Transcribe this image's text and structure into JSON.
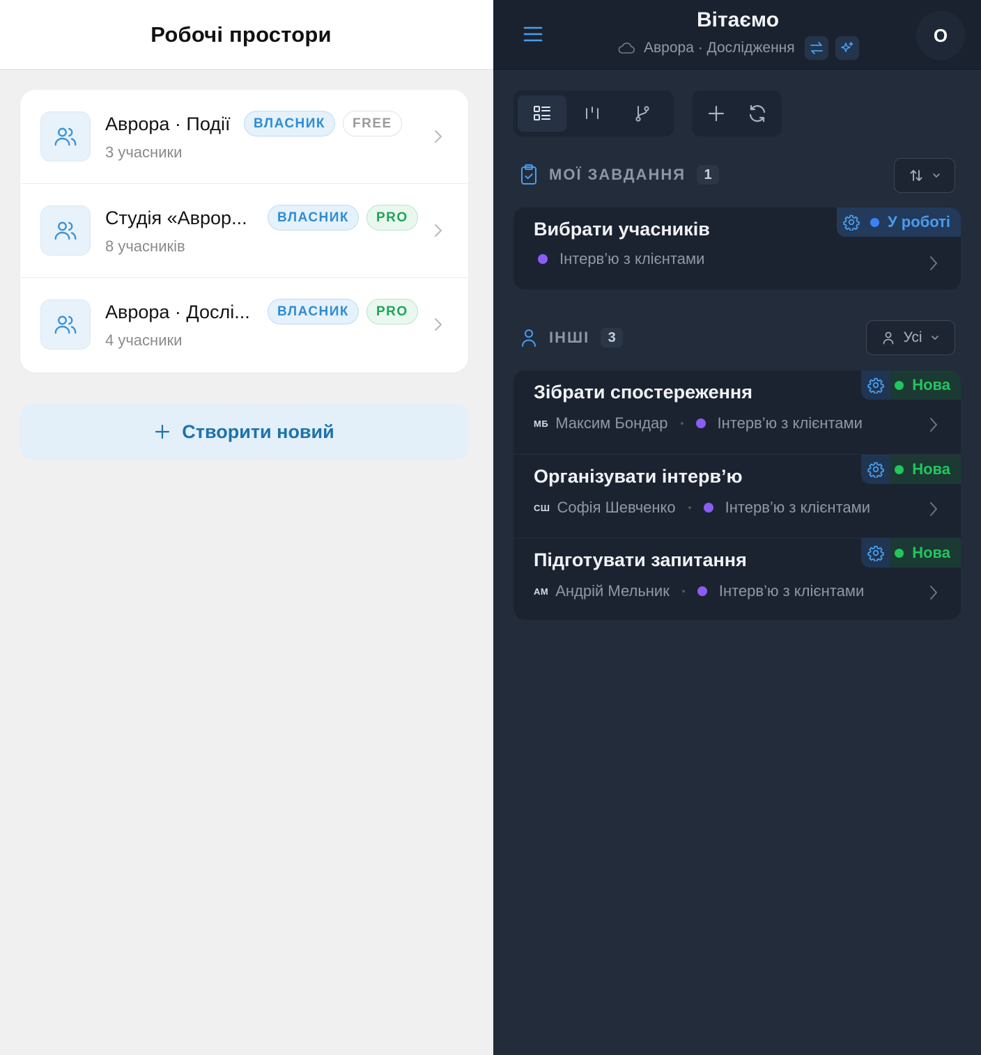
{
  "left": {
    "title": "Робочі простори",
    "workspaces": [
      {
        "name": "Аврора · Події",
        "members": "3 учасники",
        "role": "ВЛАСНИК",
        "plan": "FREE"
      },
      {
        "name": "Студія «Аврор...",
        "members": "8 учасників",
        "role": "ВЛАСНИК",
        "plan": "PRO"
      },
      {
        "name": "Аврора · Дослі...",
        "members": "4 учасники",
        "role": "ВЛАСНИК",
        "plan": "PRO"
      }
    ],
    "create_label": "Створити новий"
  },
  "right": {
    "greeting": "Вітаємо",
    "workspace": "Аврора · Дослідження",
    "avatar": "О",
    "my_tasks": {
      "title": "МОЇ ЗАВДАННЯ",
      "count": "1",
      "tasks": [
        {
          "title": "Вибрати учасників",
          "project": "Інтерв’ю з клієнтами",
          "status": "У роботі"
        }
      ]
    },
    "others": {
      "title": "ІНШІ",
      "count": "3",
      "filter": "Усі",
      "tasks": [
        {
          "title": "Зібрати спостереження",
          "initials": "МБ",
          "assignee": "Максим Бондар",
          "project": "Інтерв’ю з клієнтами",
          "status": "Нова"
        },
        {
          "title": "Організувати інтерв’ю",
          "initials": "СШ",
          "assignee": "Софія Шевченко",
          "project": "Інтерв’ю з клієнтами",
          "status": "Нова"
        },
        {
          "title": "Підготувати запитання",
          "initials": "АМ",
          "assignee": "Андрій Мельник",
          "project": "Інтерв’ю з клієнтами",
          "status": "Нова"
        }
      ]
    }
  },
  "icons": {
    "menu": "hamburger-icon",
    "cloud": "cloud-icon",
    "swap": "swap-icon",
    "sparkle": "sparkle-icon",
    "list_view": "list-view-icon",
    "board_view": "board-view-icon",
    "branch_view": "branch-icon",
    "add": "plus-icon",
    "refresh": "refresh-icon",
    "clipboard": "clipboard-icon",
    "user": "user-icon",
    "sort": "sort-icon",
    "gear": "gear-icon",
    "users": "users-icon",
    "chevron": "chevron-right-icon"
  },
  "colors": {
    "accent_blue": "#2f8cd4",
    "pro_green": "#22a35a",
    "status_progress": "#3b82f6",
    "status_new": "#22c55e",
    "project_dot": "#8b5cf6",
    "dark_bg": "#222c3b"
  }
}
